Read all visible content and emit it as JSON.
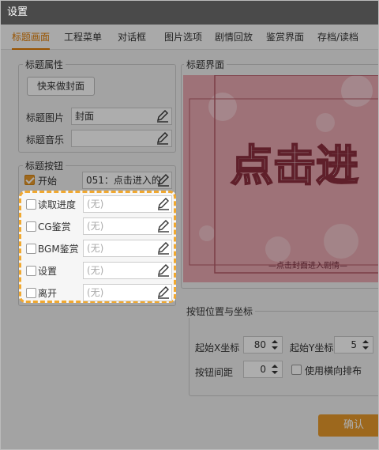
{
  "window": {
    "title": "设置"
  },
  "tabs": [
    {
      "label": "标题画面",
      "active": true
    },
    {
      "label": "工程菜单",
      "active": false
    },
    {
      "label": "对话框",
      "active": false
    },
    {
      "label": "图片选项",
      "active": false
    },
    {
      "label": "剧情回放",
      "active": false
    },
    {
      "label": "鉴赏界面",
      "active": false
    },
    {
      "label": "存档/读档",
      "active": false
    }
  ],
  "title_props": {
    "group_title": "标题属性",
    "quick_cover_button": "快来做封面",
    "image_label": "标题图片",
    "image_value": "封面",
    "music_label": "标题音乐",
    "music_value": ""
  },
  "title_buttons": {
    "group_title": "标题按钮",
    "items": [
      {
        "label": "开始",
        "checked": true,
        "value": "051：点击进入的"
      },
      {
        "label": "读取进度",
        "checked": false,
        "value": "(无)"
      },
      {
        "label": "CG鉴赏",
        "checked": false,
        "value": "(无)"
      },
      {
        "label": "BGM鉴赏",
        "checked": false,
        "value": "(无)"
      },
      {
        "label": "设置",
        "checked": false,
        "value": "(无)"
      },
      {
        "label": "离开",
        "checked": false,
        "value": "(无)"
      }
    ]
  },
  "title_screen": {
    "group_title": "标题界面",
    "preview_big_text": "点击进",
    "preview_small_text": "—点击封面进入剧情—"
  },
  "position": {
    "group_title": "按钮位置与坐标",
    "start_x_label": "起始X坐标",
    "start_x_value": "80",
    "start_y_label": "起始Y坐标",
    "start_y_value": "5",
    "spacing_label": "按钮间距",
    "spacing_value": "0",
    "horizontal_label": "使用横向排布",
    "horizontal_checked": false
  },
  "footer": {
    "confirm_label": "确认"
  },
  "colors": {
    "accent": "#e89a2c",
    "titlebar": "#4a4a4a",
    "highlight": "#f0a830"
  }
}
